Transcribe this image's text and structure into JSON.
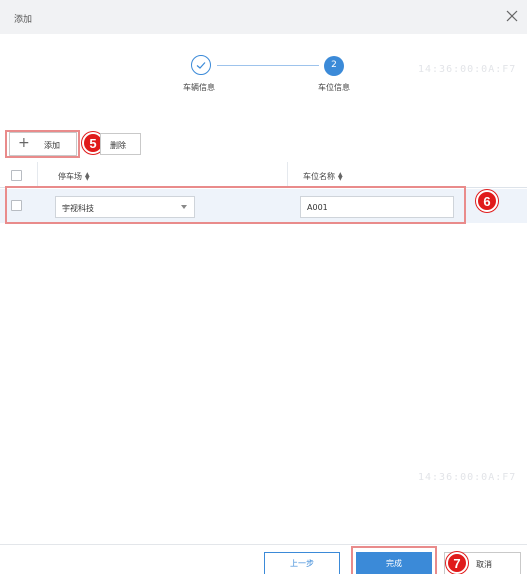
{
  "dialog": {
    "title": "添加",
    "close_icon": "close-icon"
  },
  "steps": [
    {
      "label": "车辆信息",
      "state": "completed",
      "icon": "check-icon"
    },
    {
      "label": "车位信息",
      "state": "active",
      "number": "2"
    }
  ],
  "watermark": "14:36:00:0A:F7",
  "toolbar": {
    "add_label": "添加",
    "add_icon": "plus-icon",
    "delete_label": "删除"
  },
  "table": {
    "columns": [
      "停车场",
      "车位名称"
    ],
    "rows": [
      {
        "parking_lot": "宇视科技",
        "space_name": "A001"
      }
    ]
  },
  "footer": {
    "prev_label": "上一步",
    "finish_label": "完成",
    "cancel_label": "取消"
  },
  "annotations": [
    "5",
    "6",
    "7"
  ],
  "colors": {
    "primary": "#3b8ad8",
    "highlight": "#e98b8b",
    "badge": "#e01b1b"
  }
}
